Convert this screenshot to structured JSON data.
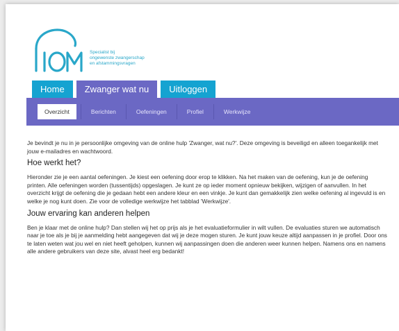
{
  "brand": {
    "logo_text": "fIOM",
    "tagline": [
      "Specialist bij",
      "ongewenste zwangerschap",
      "en afstammingsvragen"
    ],
    "accent_color": "#15a3d1",
    "nav_color": "#6b68c4"
  },
  "topnav": {
    "home": "Home",
    "zwanger": "Zwanger wat nu",
    "uitloggen": "Uitloggen"
  },
  "subnav": {
    "items": [
      "Overzicht",
      "Berichten",
      "Oefeningen",
      "Profiel",
      "Werkwijze"
    ],
    "active": "Overzicht"
  },
  "content": {
    "intro": "Je bevindt je nu in je persoonlijke omgeving van de online hulp 'Zwanger, wat nu?'. Deze omgeving is beveiligd en alleen toegankelijk met jouw e-mailadres en wachtwoord.",
    "heading1": "Hoe werkt het?",
    "para1": "Hieronder zie je een aantal oefeningen. Je kiest een oefening door erop te klikken. Na het maken van de oefening, kun je de oefening printen. Alle oefeningen worden (tussentijds) opgeslagen. Je kunt ze op ieder moment opnieuw bekijken, wijzigen of aanvullen. In het overzicht krijgt de oefening die je gedaan hebt een andere kleur en een vinkje. Je kunt dan gemakkelijk zien welke oefening al ingevuld is en welke je nog kunt doen. Zie voor de volledige werkwijze het tabblad 'Werkwijze'.",
    "heading2": "Jouw ervaring kan anderen helpen",
    "para2": "Ben je klaar met de online hulp? Dan stellen wij het op prijs als je het evaluatieformulier in wilt vullen. De evaluaties sturen we automatisch naar je toe als je bij je aanmelding hebt aangegeven dat wij je deze mogen sturen. Je kunt jouw keuze altijd aanpassen in je profiel. Door ons te laten weten wat jou wel en niet heeft geholpen, kunnen wij aanpassingen doen die anderen weer kunnen helpen. Namens ons en namens alle andere gebruikers van deze site, alvast heel erg bedankt!"
  }
}
